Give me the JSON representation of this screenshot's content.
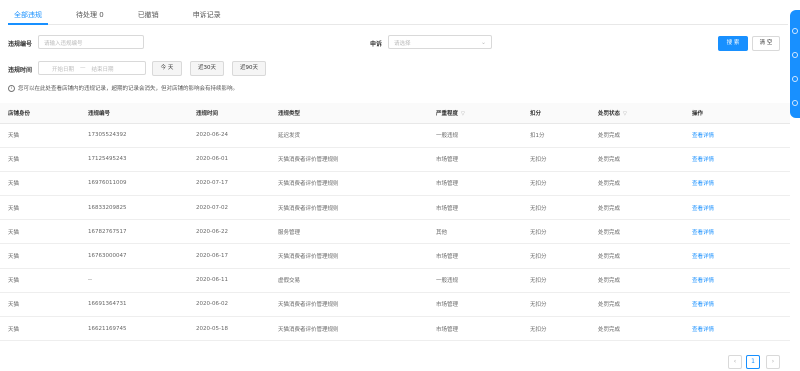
{
  "tabs": [
    {
      "label": "全部违规"
    },
    {
      "label": "待处理 0"
    },
    {
      "label": "已撤销"
    },
    {
      "label": "申诉记录"
    }
  ],
  "filters": {
    "violation_no_label": "违规编号",
    "violation_no_placeholder": "请输入违规编号",
    "appeal_label": "申诉",
    "appeal_placeholder": "请选择",
    "time_label": "违规时间",
    "start_placeholder": "开始日期",
    "range_sep": "—",
    "end_placeholder": "结束日期",
    "today": "今 天",
    "last30": "近30天",
    "last90": "近90天",
    "search": "搜 索",
    "clear": "清 空"
  },
  "notice": "您可以在此处查看店铺内的违规记录，超期的记录会消失，但对店铺的影响会有持续影响。",
  "table": {
    "columns": [
      "店铺身份",
      "违规编号",
      "违规时间",
      "违规类型",
      "严重程度",
      "扣分",
      "处罚状态",
      "操作"
    ],
    "rows": [
      [
        "天猫",
        "17305524392",
        "2020-06-24",
        "延迟发货",
        "一般违规",
        "扣1分",
        "处罚完成",
        "查看详情"
      ],
      [
        "天猫",
        "17125495243",
        "2020-06-01",
        "天猫消费者评价管理规则",
        "市场管理",
        "无扣分",
        "处罚完成",
        "查看详情"
      ],
      [
        "天猫",
        "16976011009",
        "2020-07-17",
        "天猫消费者评价管理规则",
        "市场管理",
        "无扣分",
        "处罚完成",
        "查看详情"
      ],
      [
        "天猫",
        "16833209825",
        "2020-07-02",
        "天猫消费者评价管理规则",
        "市场管理",
        "无扣分",
        "处罚完成",
        "查看详情"
      ],
      [
        "天猫",
        "16782767517",
        "2020-06-22",
        "服务管理",
        "其他",
        "无扣分",
        "处罚完成",
        "查看详情"
      ],
      [
        "天猫",
        "16763000047",
        "2020-06-17",
        "天猫消费者评价管理规则",
        "市场管理",
        "无扣分",
        "处罚完成",
        "查看详情"
      ],
      [
        "天猫",
        "--",
        "2020-06-11",
        "虚假交易",
        "一般违规",
        "无扣分",
        "处罚完成",
        "查看详情"
      ],
      [
        "天猫",
        "16691364731",
        "2020-06-02",
        "天猫消费者评价管理规则",
        "市场管理",
        "无扣分",
        "处罚完成",
        "查看详情"
      ],
      [
        "天猫",
        "16621169745",
        "2020-05-18",
        "天猫消费者评价管理规则",
        "市场管理",
        "无扣分",
        "处罚完成",
        "查看详情"
      ]
    ]
  },
  "pagination": {
    "prev": "‹",
    "current": "1",
    "next": "›"
  },
  "colors": {
    "accent": "#1890ff"
  }
}
